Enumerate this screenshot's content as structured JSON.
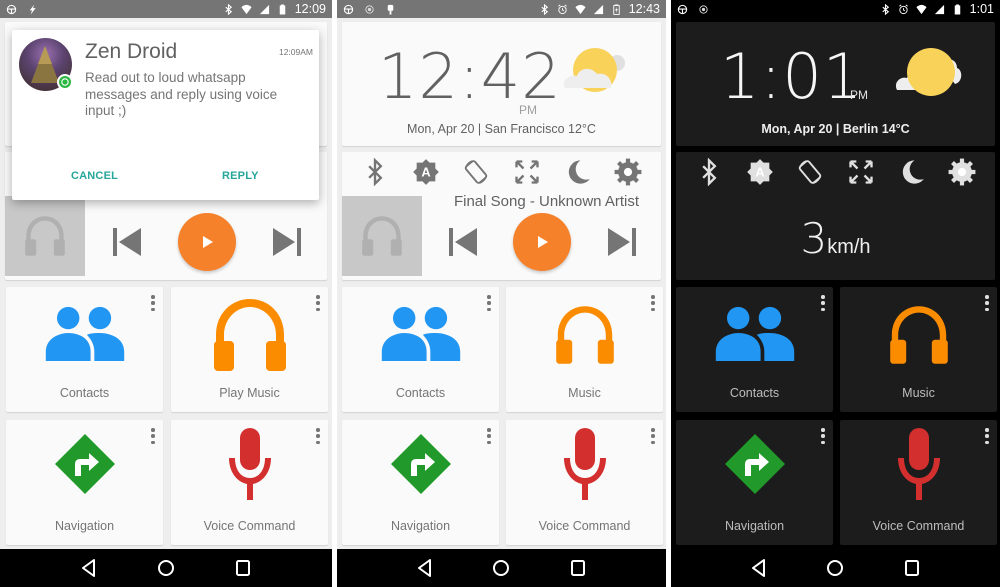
{
  "screens": [
    {
      "theme": "light",
      "status_bar": {
        "left_icons": [
          "steering-wheel-icon",
          "flash-icon"
        ],
        "right_icons": [
          "bluetooth-icon",
          "wifi-icon",
          "signal-icon",
          "battery-icon"
        ],
        "time": "12:09"
      },
      "notification": {
        "sender": "Zen Droid",
        "time": "12:09AM",
        "message": "Read out to loud whatsapp messages and reply using voice input ;)",
        "app_badge": "whatsapp-icon",
        "cancel_label": "CANCEL",
        "reply_label": "REPLY"
      },
      "media": {
        "song": "",
        "controls": [
          "previous",
          "play",
          "next"
        ]
      },
      "tiles": [
        {
          "label": "Contacts",
          "icon": "contacts-icon"
        },
        {
          "label": "Play Music",
          "icon": "play-music-icon"
        },
        {
          "label": "Navigation",
          "icon": "navigation-icon"
        },
        {
          "label": "Voice Command",
          "icon": "microphone-icon"
        }
      ]
    },
    {
      "theme": "light",
      "status_bar": {
        "left_icons": [
          "steering-wheel-icon",
          "location-icon",
          "android-icon"
        ],
        "right_icons": [
          "bluetooth-icon",
          "alarm-icon",
          "wifi-icon",
          "signal-icon",
          "battery-charging-icon"
        ],
        "time": "12:43"
      },
      "clock": {
        "time": "12:42",
        "ampm": "PM",
        "date_location": "Mon, Apr 20 | San Francisco 12°C",
        "weather": "partly-cloudy"
      },
      "toggles": [
        "bluetooth-icon",
        "auto-brightness-icon",
        "rotation-icon",
        "fullscreen-icon",
        "night-mode-icon",
        "settings-icon"
      ],
      "media": {
        "song": "Final Song - Unknown Artist",
        "controls": [
          "previous",
          "play",
          "next"
        ]
      },
      "tiles": [
        {
          "label": "Contacts",
          "icon": "contacts-icon"
        },
        {
          "label": "Music",
          "icon": "music-icon"
        },
        {
          "label": "Navigation",
          "icon": "navigation-icon"
        },
        {
          "label": "Voice Command",
          "icon": "microphone-icon"
        }
      ]
    },
    {
      "theme": "dark",
      "status_bar": {
        "left_icons": [
          "steering-wheel-icon",
          "location-icon"
        ],
        "right_icons": [
          "bluetooth-icon",
          "alarm-icon",
          "wifi-icon",
          "signal-icon",
          "battery-icon"
        ],
        "time": "1:01"
      },
      "clock": {
        "time": "1:01",
        "ampm": "PM",
        "date_location": "Mon, Apr 20 | Berlin 14°C",
        "weather": "partly-cloudy"
      },
      "toggles": [
        "bluetooth-icon",
        "auto-brightness-icon",
        "rotation-icon",
        "fullscreen-icon",
        "night-mode-icon",
        "settings-icon"
      ],
      "speedometer": {
        "value": "3",
        "unit": "km/h"
      },
      "tiles": [
        {
          "label": "Contacts",
          "icon": "contacts-icon"
        },
        {
          "label": "Music",
          "icon": "music-icon"
        },
        {
          "label": "Navigation",
          "icon": "navigation-icon"
        },
        {
          "label": "Voice Command",
          "icon": "microphone-icon"
        }
      ]
    }
  ],
  "colors": {
    "accent_orange": "#f5812b",
    "contacts_blue": "#2196f3",
    "music_orange": "#fb8c00",
    "navigation_green": "#219a2b",
    "voice_red": "#d32f2f",
    "dialog_button_teal": "#26a69a"
  }
}
